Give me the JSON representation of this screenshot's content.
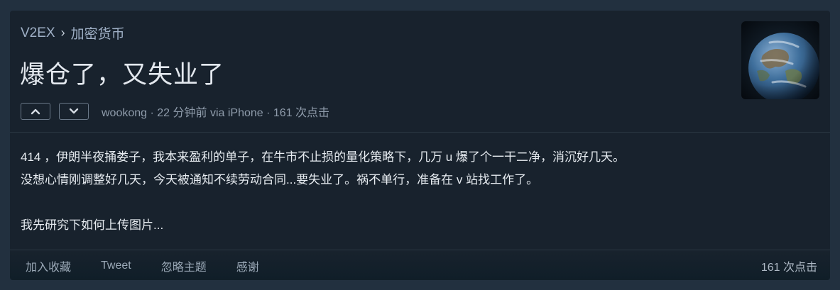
{
  "breadcrumb": {
    "site": "V2EX",
    "separator": "›",
    "node": "加密货币"
  },
  "topic": {
    "title": "爆仓了，又失业了",
    "meta": "wookong · 22 分钟前 via iPhone · 161 次点击",
    "vote_up_icon": "chevron-up-icon",
    "vote_down_icon": "chevron-down-icon",
    "avatar_icon": "earth-avatar"
  },
  "content": {
    "lines": [
      "414 ，伊朗半夜捅娄子，我本来盈利的单子，在牛市不止损的量化策略下，几万 u 爆了个一干二净，消沉好几天。",
      "没想心情刚调整好几天，今天被通知不续劳动合同...要失业了。祸不单行，准备在 v 站找工作了。",
      "我先研究下如何上传图片..."
    ]
  },
  "footer": {
    "favorite": "加入收藏",
    "tweet": "Tweet",
    "ignore": "忽略主题",
    "thank": "感谢",
    "hits": "161 次点击"
  },
  "colors": {
    "page_bg": "#22303f",
    "box_bg": "#18222d",
    "text": "#e6ebf0",
    "muted": "#8f9cab",
    "link": "#9fb0c6"
  }
}
